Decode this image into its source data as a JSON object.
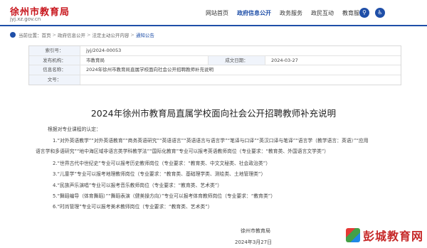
{
  "header": {
    "site_title": "徐州市教育局",
    "domain": "jyj.xz.gov.cn",
    "nav": [
      "网站首页",
      "政府信息公开",
      "政务服务",
      "政民互动",
      "教育服务"
    ],
    "active_nav": 1
  },
  "breadcrumb": {
    "prefix": "当前位置：",
    "items": [
      "首页",
      "政府信息公开",
      "法定主动公开内容",
      "通知公告"
    ]
  },
  "info": {
    "index_label": "索引号：",
    "index_value": "jyj/2024-00053",
    "org_label": "发布机构：",
    "org_value": "市教育局",
    "date_label": "成文日期：",
    "date_value": "2024-03-27",
    "name_label": "信息名称：",
    "name_value": "2024年徐州市教育局直属学校面向社会公开招聘教师补充说明",
    "doc_label": "文号：",
    "doc_value": ""
  },
  "article": {
    "title": "2024年徐州市教育局直属学校面向社会公开招聘教师补充说明",
    "p0": "根据对专业课程的认定：",
    "p1": "1.“对外英语教学”“对外英语教育”“商务英语研究”“英语语言”“英语语言与语言学”“笔译与口译”“英汉口译与笔译”“语言学（教学语言：英语）”“应用",
    "p1b": "语言学和多语研究”“地中海区域非语言类学科教学法”“国际化教育”专业可以报考英语教师岗位（专业要求：“教育类、外国语言文学类”）",
    "p2": "2.“世界古代中世纪史”专业可以报考历史教师岗位（专业要求：“教育类、中文文秘类、社会政治类”）",
    "p3": "3.“儿童学”专业可以报考地理教师岗位（专业要求：“教育类、基础理学类、测绘类、土地管理类”）",
    "p4": "4.“民族声乐演唱”专业可以报考音乐教师岗位（专业要求：“教育类、艺术类”）",
    "p5": "5.“舞蹈编导（体育舞蹈）”“舞蹈表演（健美操方向）”专业可以报考体育教师岗位（专业要求：“教育类”）",
    "p6": "6.“时尚管理”专业可以报考美术教师岗位（专业要求：“教育类、艺术类”）",
    "signature": "徐州市教育局",
    "date": "2024年3月27日"
  },
  "watermark": {
    "text": "彭城教育网"
  }
}
